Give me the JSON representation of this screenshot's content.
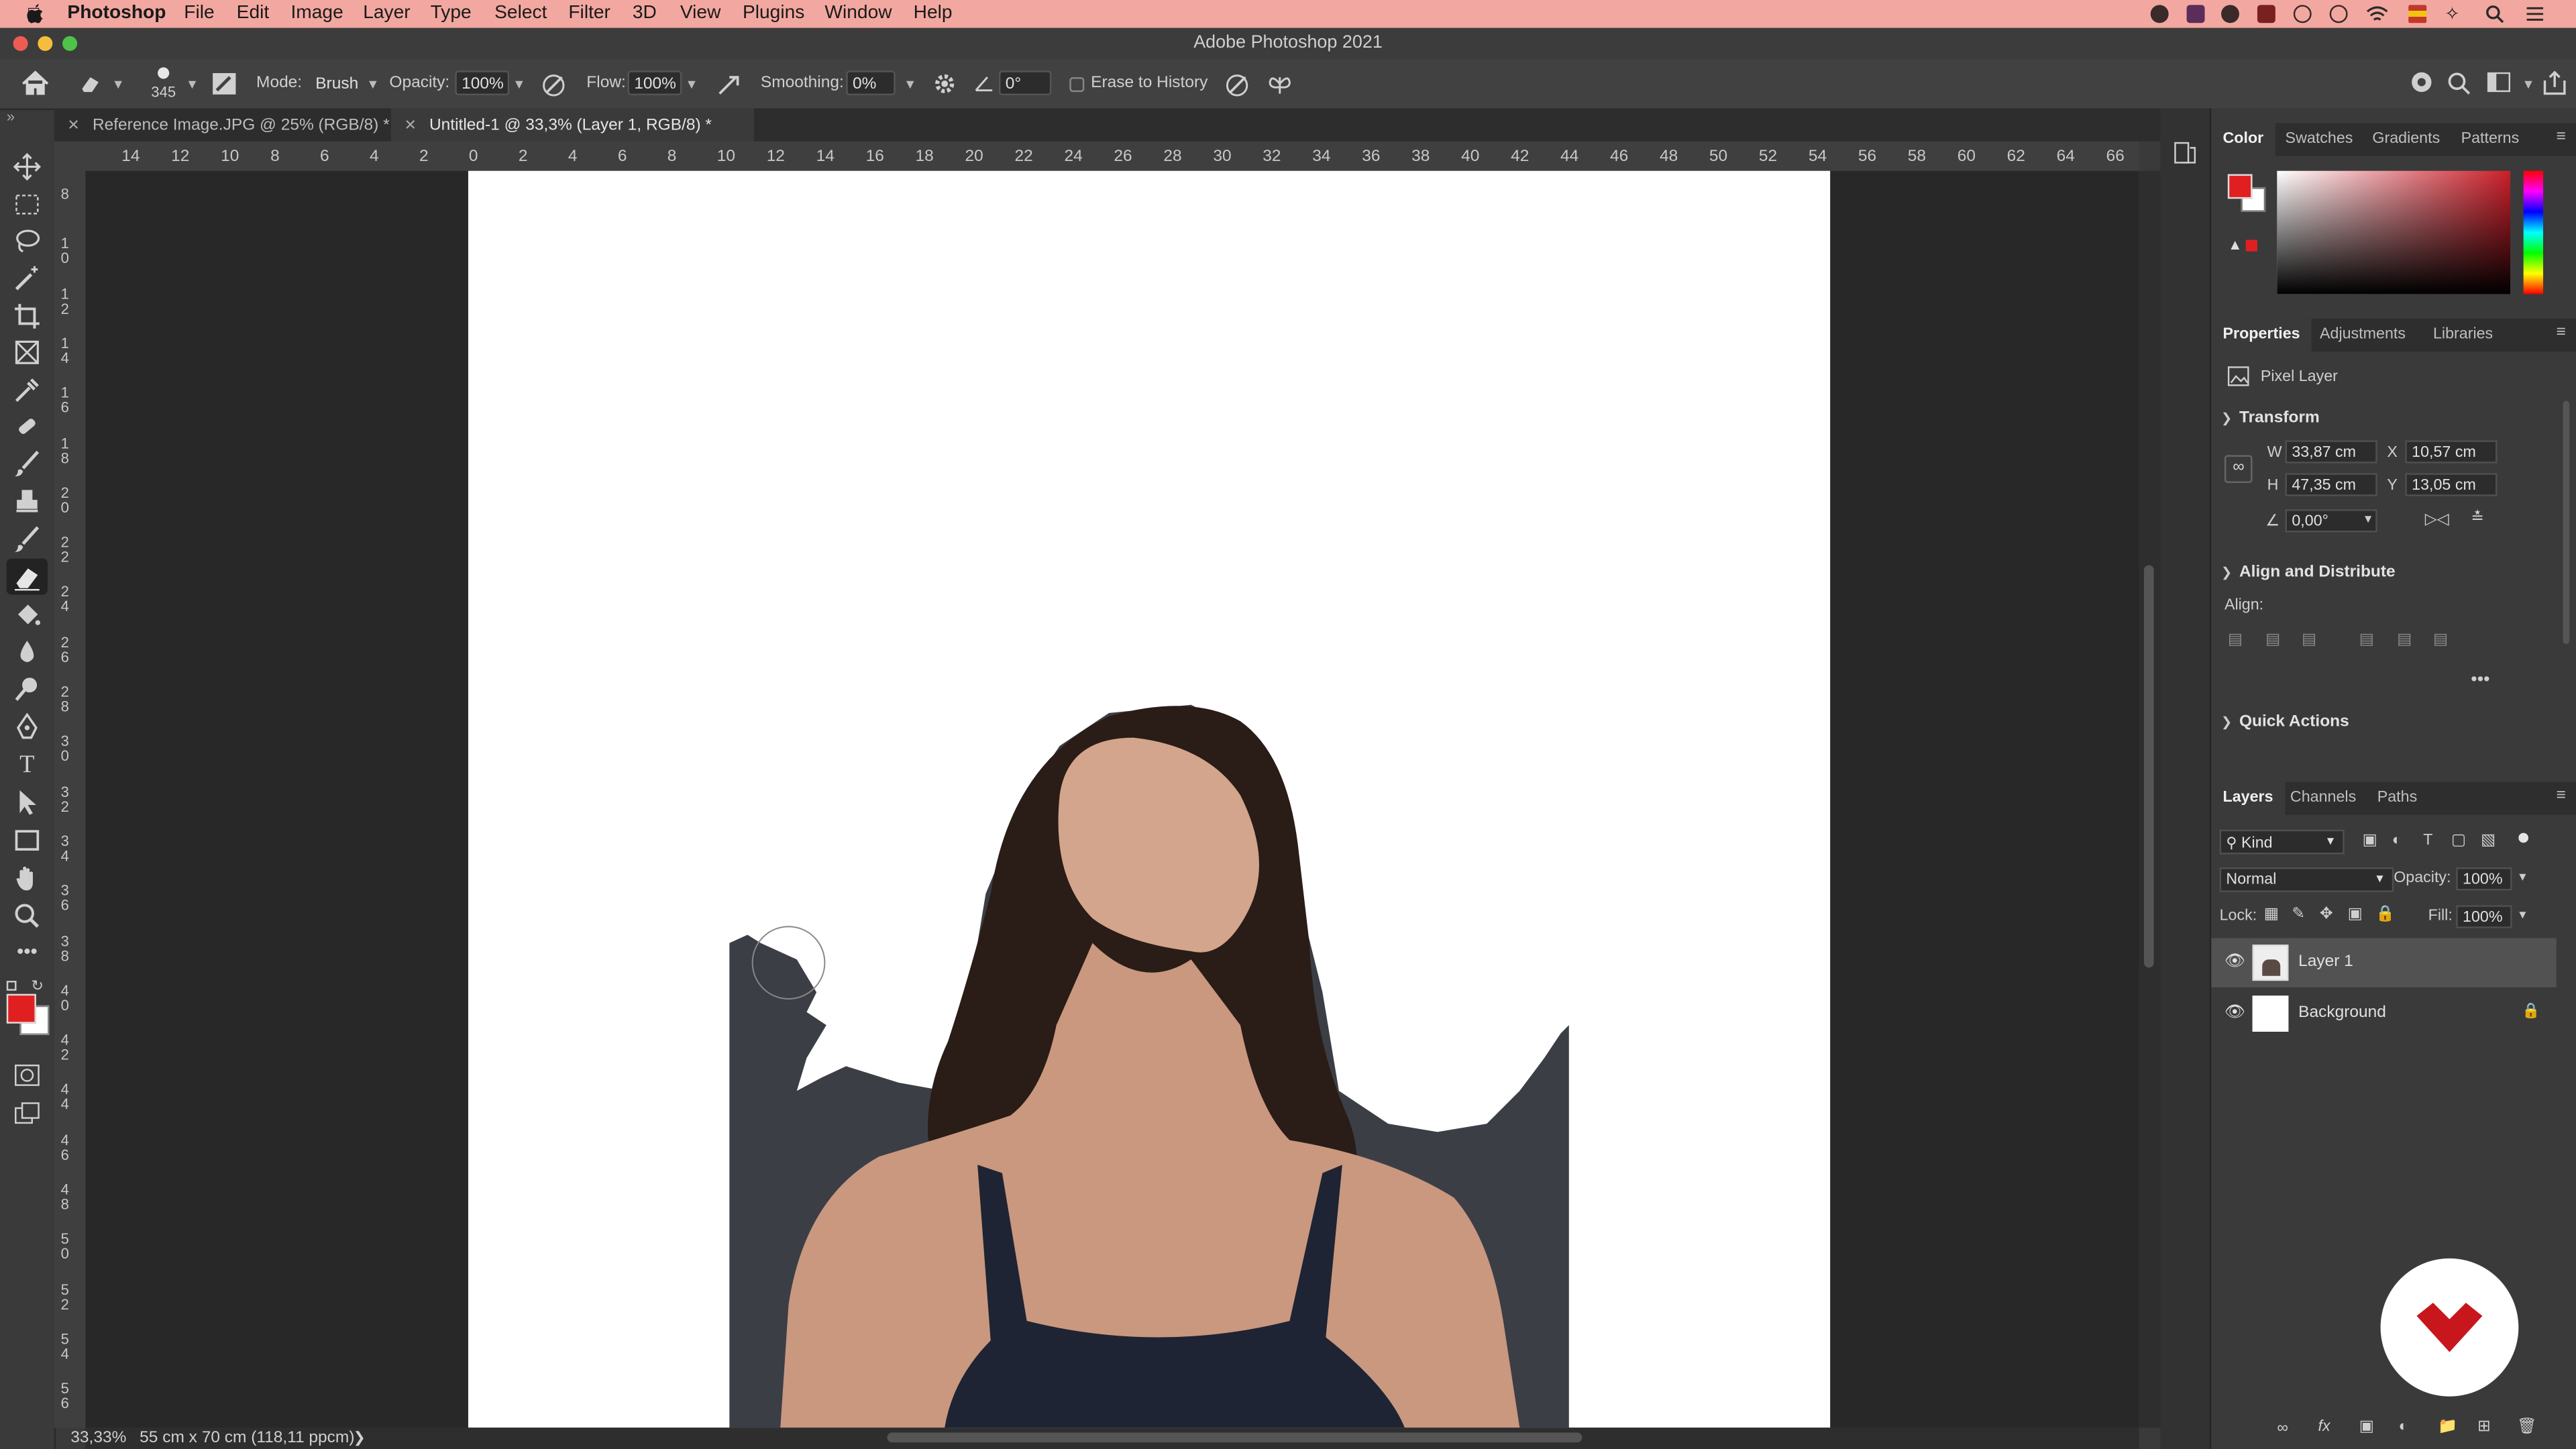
{
  "menubar": {
    "apple": "",
    "app_name": "Photoshop",
    "items": [
      "File",
      "Edit",
      "Image",
      "Layer",
      "Type",
      "Select",
      "Filter",
      "3D",
      "View",
      "Plugins",
      "Window",
      "Help"
    ]
  },
  "window": {
    "title": "Adobe Photoshop 2021"
  },
  "options": {
    "brush_size": "345",
    "mode_label": "Mode:",
    "mode_value": "Brush",
    "opacity_label": "Opacity:",
    "opacity_value": "100%",
    "flow_label": "Flow:",
    "flow_value": "100%",
    "smoothing_label": "Smoothing:",
    "smoothing_value": "0%",
    "angle_value": "0°",
    "erase_history_label": "Erase to History"
  },
  "tabs": [
    {
      "label": "Reference Image.JPG @ 25% (RGB/8) *",
      "active": false
    },
    {
      "label": "Untitled-1 @ 33,3% (Layer 1, RGB/8) *",
      "active": true
    }
  ],
  "ruler_top": [
    "14",
    "12",
    "10",
    "8",
    "6",
    "4",
    "2",
    "0",
    "2",
    "4",
    "6",
    "8",
    "10",
    "12",
    "14",
    "16",
    "18",
    "20",
    "22",
    "24",
    "26",
    "28",
    "30",
    "32",
    "34",
    "36",
    "38",
    "40",
    "42",
    "44",
    "46",
    "48",
    "50",
    "52",
    "54",
    "56",
    "58",
    "60",
    "62",
    "64",
    "66"
  ],
  "ruler_left": [
    "8",
    "1 0",
    "1 2",
    "1 4",
    "1 6",
    "1 8",
    "2 0",
    "2 2",
    "2 4",
    "2 6",
    "2 8",
    "3 0",
    "3 2",
    "3 4",
    "3 6",
    "3 8",
    "4 0",
    "4 2",
    "4 4",
    "4 6",
    "4 8",
    "5 0",
    "5 2",
    "5 4",
    "5 6"
  ],
  "status": {
    "zoom": "33,33%",
    "doc_size": "55 cm x 70 cm (118,11 ppcm)"
  },
  "color_panel": {
    "tabs": [
      "Color",
      "Swatches",
      "Gradients",
      "Patterns"
    ],
    "foreground": "#e02020",
    "background": "#ffffff"
  },
  "properties_panel": {
    "tabs": [
      "Properties",
      "Adjustments",
      "Libraries"
    ],
    "layer_type": "Pixel Layer",
    "transform_title": "Transform",
    "w_label": "W",
    "w_value": "33,87 cm",
    "h_label": "H",
    "h_value": "47,35 cm",
    "x_label": "X",
    "x_value": "10,57 cm",
    "y_label": "Y",
    "y_value": "13,05 cm",
    "angle_value": "0,00°",
    "align_title": "Align and Distribute",
    "align_label": "Align:",
    "quick_actions_title": "Quick Actions"
  },
  "layers_panel": {
    "tabs": [
      "Layers",
      "Channels",
      "Paths"
    ],
    "filter_kind": "Kind",
    "blend_mode": "Normal",
    "opacity_label": "Opacity:",
    "opacity_value": "100%",
    "lock_label": "Lock:",
    "fill_label": "Fill:",
    "fill_value": "100%",
    "layers": [
      {
        "name": "Layer 1",
        "selected": true
      },
      {
        "name": "Background",
        "selected": false
      }
    ]
  }
}
